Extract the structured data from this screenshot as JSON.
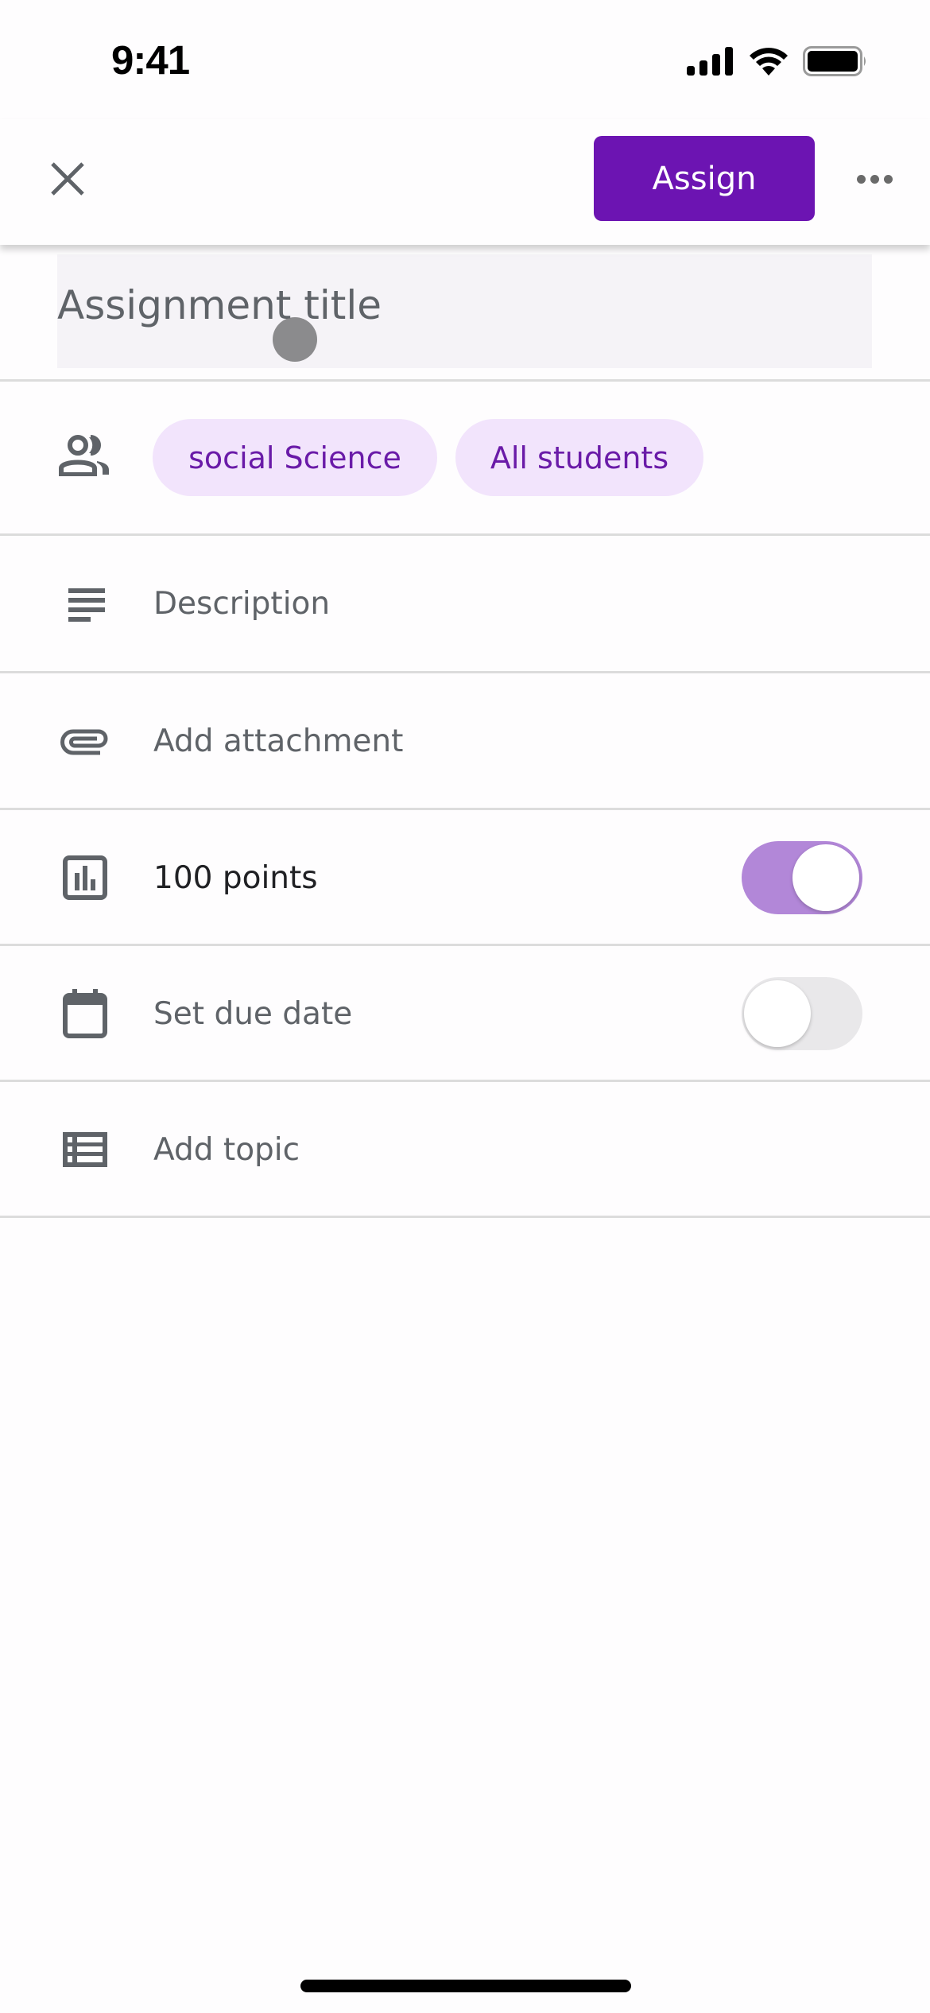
{
  "status_bar": {
    "time": "9:41",
    "icons": [
      "cellular-signal-icon",
      "wifi-icon",
      "battery-icon"
    ]
  },
  "header": {
    "close_icon": "close-icon",
    "assign_label": "Assign",
    "more_icon": "more-horizontal-icon"
  },
  "title_field": {
    "value": "",
    "placeholder": "Assignment title"
  },
  "audience": {
    "icon": "people-icon",
    "chips": [
      {
        "label": "social Science"
      },
      {
        "label": "All students"
      }
    ]
  },
  "rows": {
    "description": {
      "icon": "notes-icon",
      "label": "Description"
    },
    "attachment": {
      "icon": "paperclip-icon",
      "label": "Add attachment"
    },
    "points": {
      "icon": "grade-chart-icon",
      "label": "100 points",
      "toggle_on": true
    },
    "due_date": {
      "icon": "calendar-icon",
      "label": "Set due date",
      "toggle_on": false
    },
    "topic": {
      "icon": "topic-list-icon",
      "label": "Add topic"
    }
  },
  "colors": {
    "accent": "#6c14b2",
    "chip_bg": "#f2e4fc",
    "chip_text": "#6a1ba8",
    "toggle_on": "#b287d8",
    "toggle_off": "#e9e8ea"
  }
}
